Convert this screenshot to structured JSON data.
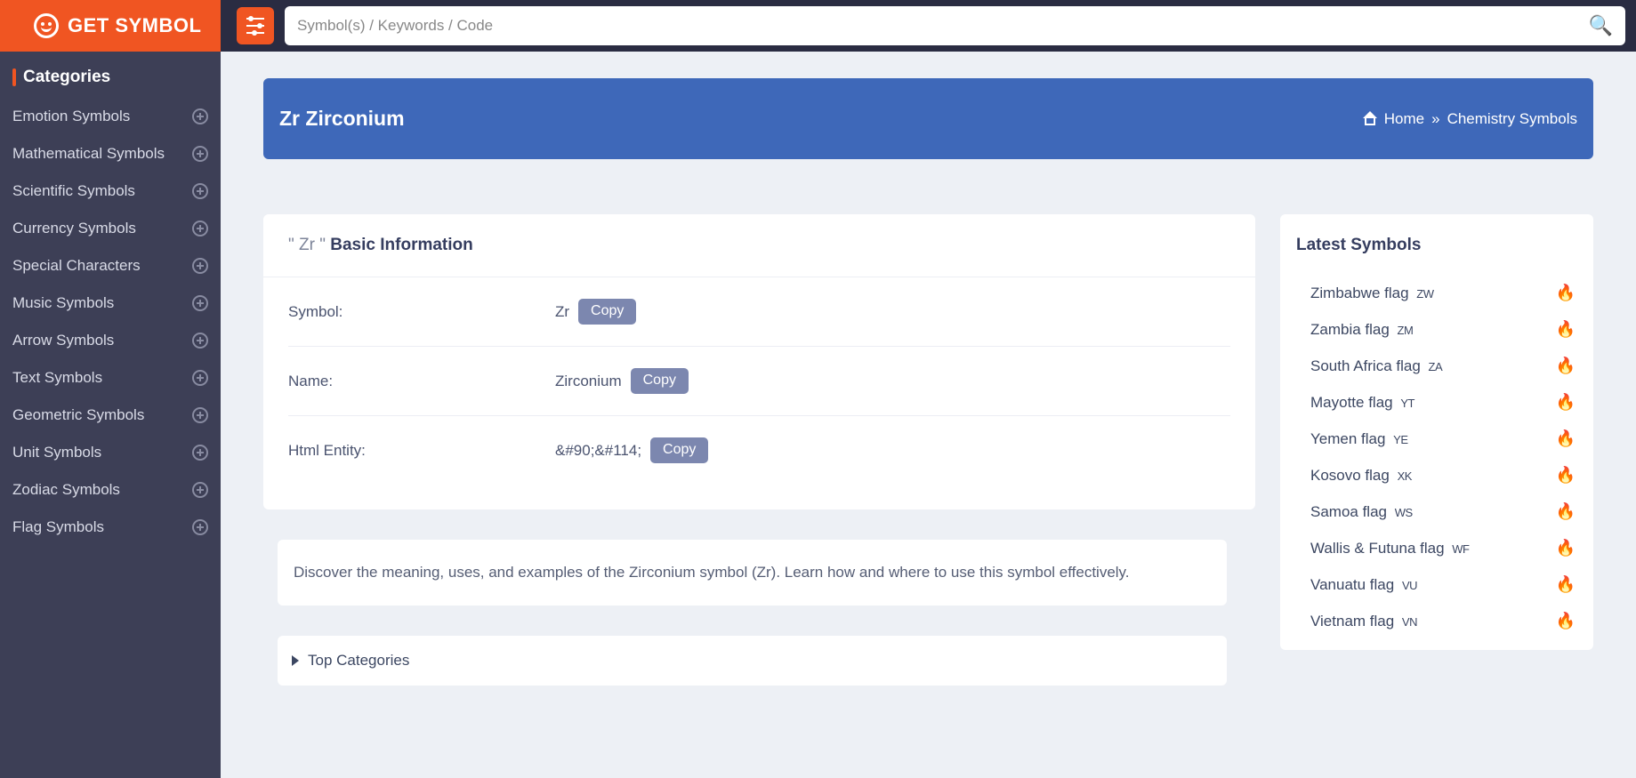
{
  "brand": "GET SYMBOL",
  "search": {
    "placeholder": "Symbol(s) / Keywords / Code"
  },
  "sidebar": {
    "title": "Categories",
    "items": [
      "Emotion Symbols",
      "Mathematical Symbols",
      "Scientific Symbols",
      "Currency Symbols",
      "Special Characters",
      "Music Symbols",
      "Arrow Symbols",
      "Text Symbols",
      "Geometric Symbols",
      "Unit Symbols",
      "Zodiac Symbols",
      "Flag Symbols"
    ]
  },
  "hero": {
    "title": "Zr Zirconium",
    "breadcrumb": {
      "home": "Home",
      "sep": "»",
      "current": "Chemistry Symbols"
    }
  },
  "info": {
    "heading_prefix": "\" Zr \"  ",
    "heading_bold": "Basic Information",
    "rows": [
      {
        "label": "Symbol:",
        "value": "Zr",
        "copy": "Copy"
      },
      {
        "label": "Name:",
        "value": "Zirconium",
        "copy": "Copy"
      },
      {
        "label": "Html Entity:",
        "value": "&#90;&#114;",
        "copy": "Copy"
      }
    ]
  },
  "description": "Discover the meaning, uses, and examples of the Zirconium symbol (Zr). Learn how and where to use this symbol effectively.",
  "accordion": {
    "title": "Top Categories"
  },
  "latest": {
    "title": "Latest Symbols",
    "items": [
      {
        "name": "Zimbabwe flag",
        "glyph": "ZW"
      },
      {
        "name": "Zambia flag",
        "glyph": "ZM"
      },
      {
        "name": "South Africa flag",
        "glyph": "ZA"
      },
      {
        "name": "Mayotte flag",
        "glyph": "YT"
      },
      {
        "name": "Yemen flag",
        "glyph": "YE"
      },
      {
        "name": "Kosovo flag",
        "glyph": "XK"
      },
      {
        "name": "Samoa flag",
        "glyph": "WS"
      },
      {
        "name": "Wallis & Futuna flag",
        "glyph": "WF"
      },
      {
        "name": "Vanuatu flag",
        "glyph": "VU"
      },
      {
        "name": "Vietnam flag",
        "glyph": "VN"
      }
    ]
  }
}
